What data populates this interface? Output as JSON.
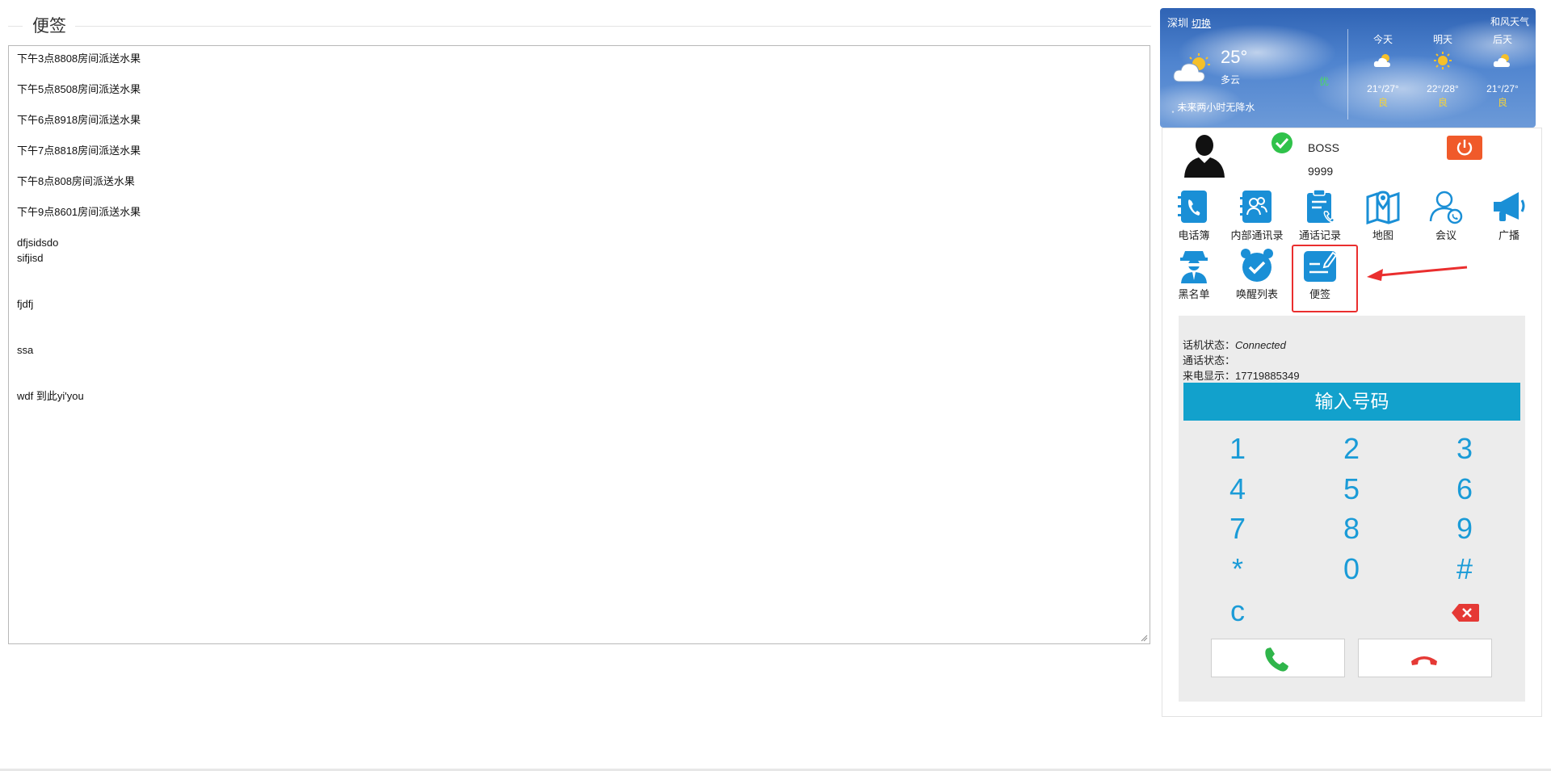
{
  "panel": {
    "title": "便签",
    "notes": [
      "下午3点8808房间派送水果",
      "",
      "下午5点8508房间派送水果",
      "",
      "下午6点8918房间派送水果",
      "",
      "下午7点8818房间派送水果",
      "",
      "下午8点808房间派送水果",
      "",
      "下午9点8601房间派送水果",
      "",
      "dfjsidsdo",
      "sifjisd",
      "",
      "",
      "fjdfj",
      "",
      "",
      "ssa",
      "",
      "",
      "wdf 到此yi'you"
    ]
  },
  "weather": {
    "city": "深圳",
    "switch_label": "切换",
    "brand": "和风天气",
    "temp": "25°",
    "condition": "多云",
    "aqi": "优",
    "rain": "未来两小时无降水",
    "days": [
      {
        "name": "今天",
        "temp": "21°/27°",
        "quality": "良",
        "icon": "partly-cloudy-icon"
      },
      {
        "name": "明天",
        "temp": "22°/28°",
        "quality": "良",
        "icon": "sun-icon"
      },
      {
        "name": "后天",
        "temp": "21°/27°",
        "quality": "良",
        "icon": "partly-cloudy-icon"
      }
    ]
  },
  "user": {
    "name": "BOSS",
    "ext": "9999",
    "status": "online"
  },
  "apps": {
    "phonebook": "电话簿",
    "internal": "内部通讯录",
    "calllog": "通话记录",
    "map": "地图",
    "meeting": "会议",
    "broadcast": "广播",
    "blacklist": "黑名单",
    "wakeup": "唤醒列表",
    "notes": "便签"
  },
  "status": {
    "phone_label": "话机状态：",
    "phone_value": "Connected",
    "call_label": "通话状态：",
    "call_value": "",
    "caller_label": "来电显示：",
    "caller_value": "17719885349"
  },
  "dialer": {
    "input_label": "输入号码",
    "keys": [
      "1",
      "2",
      "3",
      "4",
      "5",
      "6",
      "7",
      "8",
      "9",
      "*",
      "0",
      "#"
    ],
    "clear": "c"
  },
  "colors": {
    "accent": "#12a1cc",
    "key": "#1a9bd7",
    "power": "#f05a2a",
    "highlight": "#ea2e2e",
    "call": "#2fb54a",
    "hangup": "#e53935"
  }
}
